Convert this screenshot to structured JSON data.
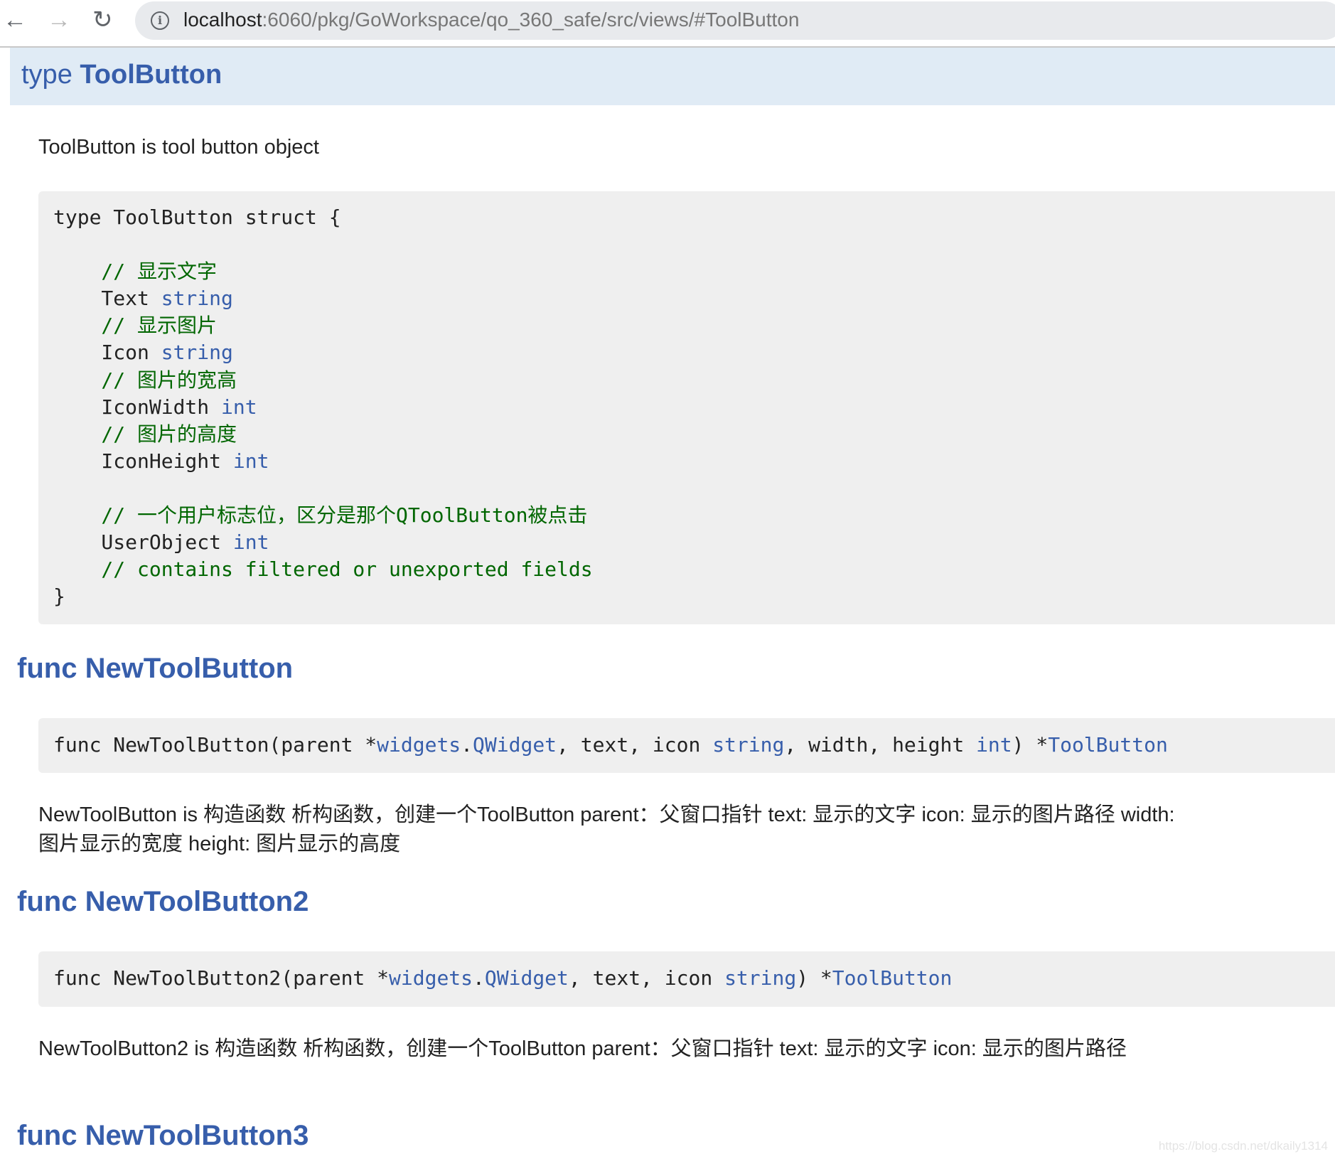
{
  "browser": {
    "back_icon": "arrow-left",
    "forward_icon": "arrow-right",
    "reload_icon": "reload",
    "url_host": "localhost",
    "url_rest": ":6060/pkg/GoWorkspace/qo_360_safe/src/views/#ToolButton"
  },
  "type_header": {
    "prefix": "type",
    "name": "ToolButton"
  },
  "type_doc": "ToolButton is tool button object",
  "struct_code": [
    [
      {
        "t": "type ToolButton struct {",
        "c": ""
      }
    ],
    [],
    [
      {
        "t": "    // 显示文字",
        "c": "cm"
      }
    ],
    [
      {
        "t": "    Text ",
        "c": ""
      },
      {
        "t": "string",
        "c": "kw"
      }
    ],
    [
      {
        "t": "    // 显示图片",
        "c": "cm"
      }
    ],
    [
      {
        "t": "    Icon ",
        "c": ""
      },
      {
        "t": "string",
        "c": "kw"
      }
    ],
    [
      {
        "t": "    // 图片的宽高",
        "c": "cm"
      }
    ],
    [
      {
        "t": "    IconWidth ",
        "c": ""
      },
      {
        "t": "int",
        "c": "kw"
      }
    ],
    [
      {
        "t": "    // 图片的高度",
        "c": "cm"
      }
    ],
    [
      {
        "t": "    IconHeight ",
        "c": ""
      },
      {
        "t": "int",
        "c": "kw"
      }
    ],
    [],
    [
      {
        "t": "    // 一个用户标志位，区分是那个QToolButton被点击",
        "c": "cm"
      }
    ],
    [
      {
        "t": "    UserObject ",
        "c": ""
      },
      {
        "t": "int",
        "c": "kw"
      }
    ],
    [
      {
        "t": "    // contains filtered or unexported fields",
        "c": "cm"
      }
    ],
    [
      {
        "t": "}",
        "c": ""
      }
    ]
  ],
  "funcs": [
    {
      "prefix": "func",
      "name": "NewToolButton",
      "signature": [
        {
          "t": "func NewToolButton(parent *",
          "c": ""
        },
        {
          "t": "widgets",
          "c": "kw"
        },
        {
          "t": ".",
          "c": ""
        },
        {
          "t": "QWidget",
          "c": "kw"
        },
        {
          "t": ", text, icon ",
          "c": ""
        },
        {
          "t": "string",
          "c": "kw"
        },
        {
          "t": ", width, height ",
          "c": ""
        },
        {
          "t": "int",
          "c": "kw"
        },
        {
          "t": ") *",
          "c": ""
        },
        {
          "t": "ToolButton",
          "c": "kw"
        }
      ],
      "doc": "NewToolButton is 构造函数 析构函数，创建一个ToolButton parent：父窗口指针 text: 显示的文字 icon: 显示的图片路径 width: 图片显示的宽度 height: 图片显示的高度"
    },
    {
      "prefix": "func",
      "name": "NewToolButton2",
      "signature": [
        {
          "t": "func NewToolButton2(parent *",
          "c": ""
        },
        {
          "t": "widgets",
          "c": "kw"
        },
        {
          "t": ".",
          "c": ""
        },
        {
          "t": "QWidget",
          "c": "kw"
        },
        {
          "t": ", text, icon ",
          "c": ""
        },
        {
          "t": "string",
          "c": "kw"
        },
        {
          "t": ") *",
          "c": ""
        },
        {
          "t": "ToolButton",
          "c": "kw"
        }
      ],
      "doc": "NewToolButton2 is 构造函数 析构函数，创建一个ToolButton parent：父窗口指针 text: 显示的文字 icon: 显示的图片路径"
    },
    {
      "prefix": "func",
      "name": "NewToolButton3"
    }
  ],
  "watermark": "https://blog.csdn.net/dkaily1314"
}
